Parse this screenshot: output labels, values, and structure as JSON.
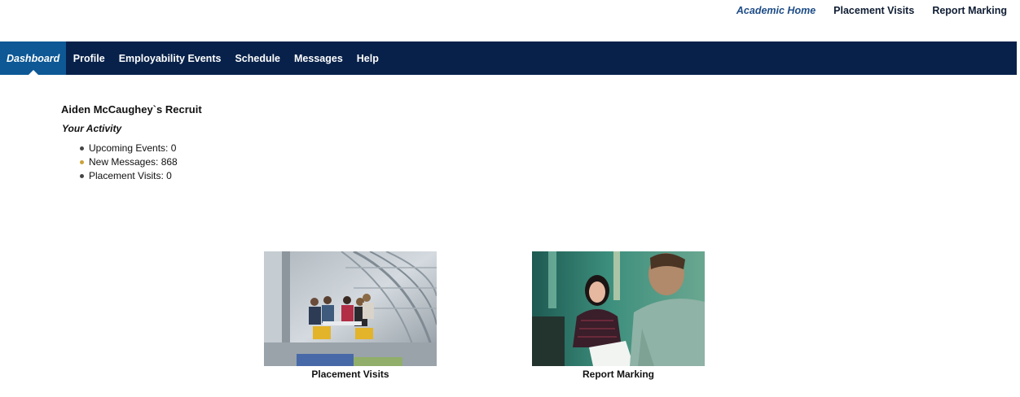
{
  "top_links": [
    {
      "label": "Academic Home",
      "active": true
    },
    {
      "label": "Placement Visits",
      "active": false
    },
    {
      "label": "Report Marking",
      "active": false
    }
  ],
  "nav": {
    "items": [
      {
        "label": "Dashboard",
        "active": true
      },
      {
        "label": "Profile",
        "active": false
      },
      {
        "label": "Employability Events",
        "active": false
      },
      {
        "label": "Schedule",
        "active": false
      },
      {
        "label": "Messages",
        "active": false
      },
      {
        "label": "Help",
        "active": false
      }
    ]
  },
  "main": {
    "title": "Aiden McCaughey`s Recruit",
    "activity_heading": "Your Activity",
    "activity": [
      {
        "text": "Upcoming Events: 0"
      },
      {
        "text": "New Messages: 868"
      },
      {
        "text": "Placement Visits: 0"
      }
    ]
  },
  "tiles": [
    {
      "label": "Placement Visits",
      "image": "group-meeting-photo"
    },
    {
      "label": "Report Marking",
      "image": "student-meeting-photo"
    }
  ],
  "colors": {
    "nav_background": "#07214a",
    "nav_active": "#0d5895",
    "link_active": "#1d4c86",
    "bullet_highlight": "#c9a23a"
  }
}
